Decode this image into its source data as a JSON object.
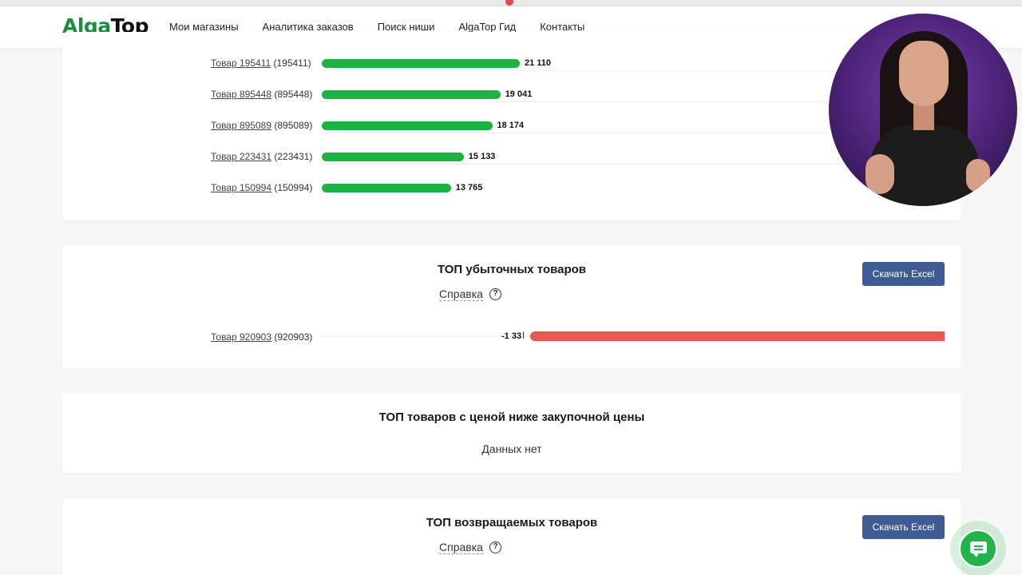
{
  "header": {
    "logo": {
      "part1": "Alga",
      "part2": "Top"
    },
    "nav": [
      "Мои магазины",
      "Аналитика заказов",
      "Поиск ниши",
      "AlgaTop Гид",
      "Контакты"
    ]
  },
  "top_products": {
    "rows": [
      {
        "name": "Товар 195411",
        "id": "(195411)",
        "value_label": "21 110",
        "value": 21110
      },
      {
        "name": "Товар 895448",
        "id": "(895448)",
        "value_label": "19 041",
        "value": 19041
      },
      {
        "name": "Товар 895089",
        "id": "(895089)",
        "value_label": "18 174",
        "value": 18174
      },
      {
        "name": "Товар 223431",
        "id": "(223431)",
        "value_label": "15 133",
        "value": 15133
      },
      {
        "name": "Товар 150994",
        "id": "(150994)",
        "value_label": "13 765",
        "value": 13765
      }
    ],
    "bar_color": "#1db343"
  },
  "loss_products": {
    "title": "ТОП убыточных товаров",
    "help": "Справка",
    "excel_button": "Скачать Excel",
    "rows": [
      {
        "name": "Товар 920903",
        "id": "(920903)",
        "value_label": "-1 33",
        "value": -1330
      }
    ],
    "bar_color": "#e85a50"
  },
  "below_purchase_price": {
    "title": "ТОП товаров с ценой ниже закупочной цены",
    "empty_text": "Данных нет"
  },
  "returned_products": {
    "title": "ТОП возвращаемых товаров",
    "help": "Справка",
    "excel_button": "Скачать Excel"
  },
  "icons": [
    "help-circle-icon",
    "chat-icon"
  ],
  "colors": {
    "brand_green": "#1e8c3e",
    "button_blue": "#3f5b94"
  }
}
